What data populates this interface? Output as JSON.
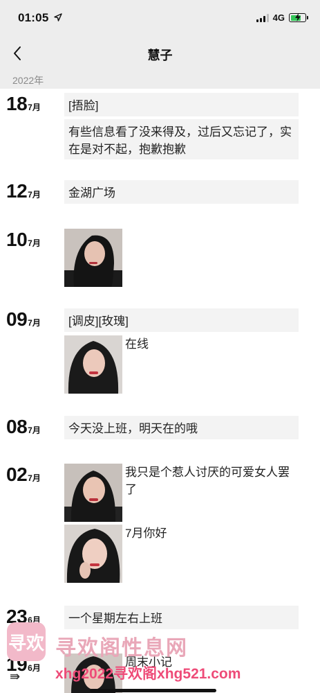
{
  "status_bar": {
    "time": "01:05",
    "network": "4G",
    "icons": [
      "location-arrow-icon",
      "signal-icon",
      "battery-charging-icon"
    ]
  },
  "nav": {
    "title": "慧子",
    "back_icon": "chevron-left-icon"
  },
  "year": "2022年",
  "entries": [
    {
      "day": "18",
      "month": "7月",
      "texts": [
        "[捂脸]",
        "有些信息看了没来得及，过后又忘记了，实在是对不起，抱歉抱歉"
      ]
    },
    {
      "day": "12",
      "month": "7月",
      "texts": [
        "金湖广场"
      ]
    },
    {
      "day": "10",
      "month": "7月",
      "photos": [
        {
          "caption": ""
        }
      ]
    },
    {
      "day": "09",
      "month": "7月",
      "texts": [
        "[调皮][玫瑰]"
      ],
      "photos": [
        {
          "caption": "在线"
        }
      ]
    },
    {
      "day": "08",
      "month": "7月",
      "texts": [
        "今天没上班，明天在的哦"
      ]
    },
    {
      "day": "02",
      "month": "7月",
      "photos": [
        {
          "caption": "我只是个惹人讨厌的可爱女人罢了"
        },
        {
          "caption": "7月你好"
        }
      ]
    },
    {
      "day": "23",
      "month": "6月",
      "texts": [
        "一个星期左右上班"
      ]
    },
    {
      "day": "19",
      "month": "6月",
      "photos": [
        {
          "caption": "周末小记"
        }
      ]
    }
  ],
  "watermark": {
    "logo_text": "寻欢",
    "title": "寻欢阁性息网",
    "url": "xhg2022寻欢阁xhg521.com"
  },
  "colors": {
    "header_bg": "#ededed",
    "bubble_bg": "#f3f3f3",
    "battery_green": "#34c759",
    "watermark_pink": "#ee4b78"
  }
}
